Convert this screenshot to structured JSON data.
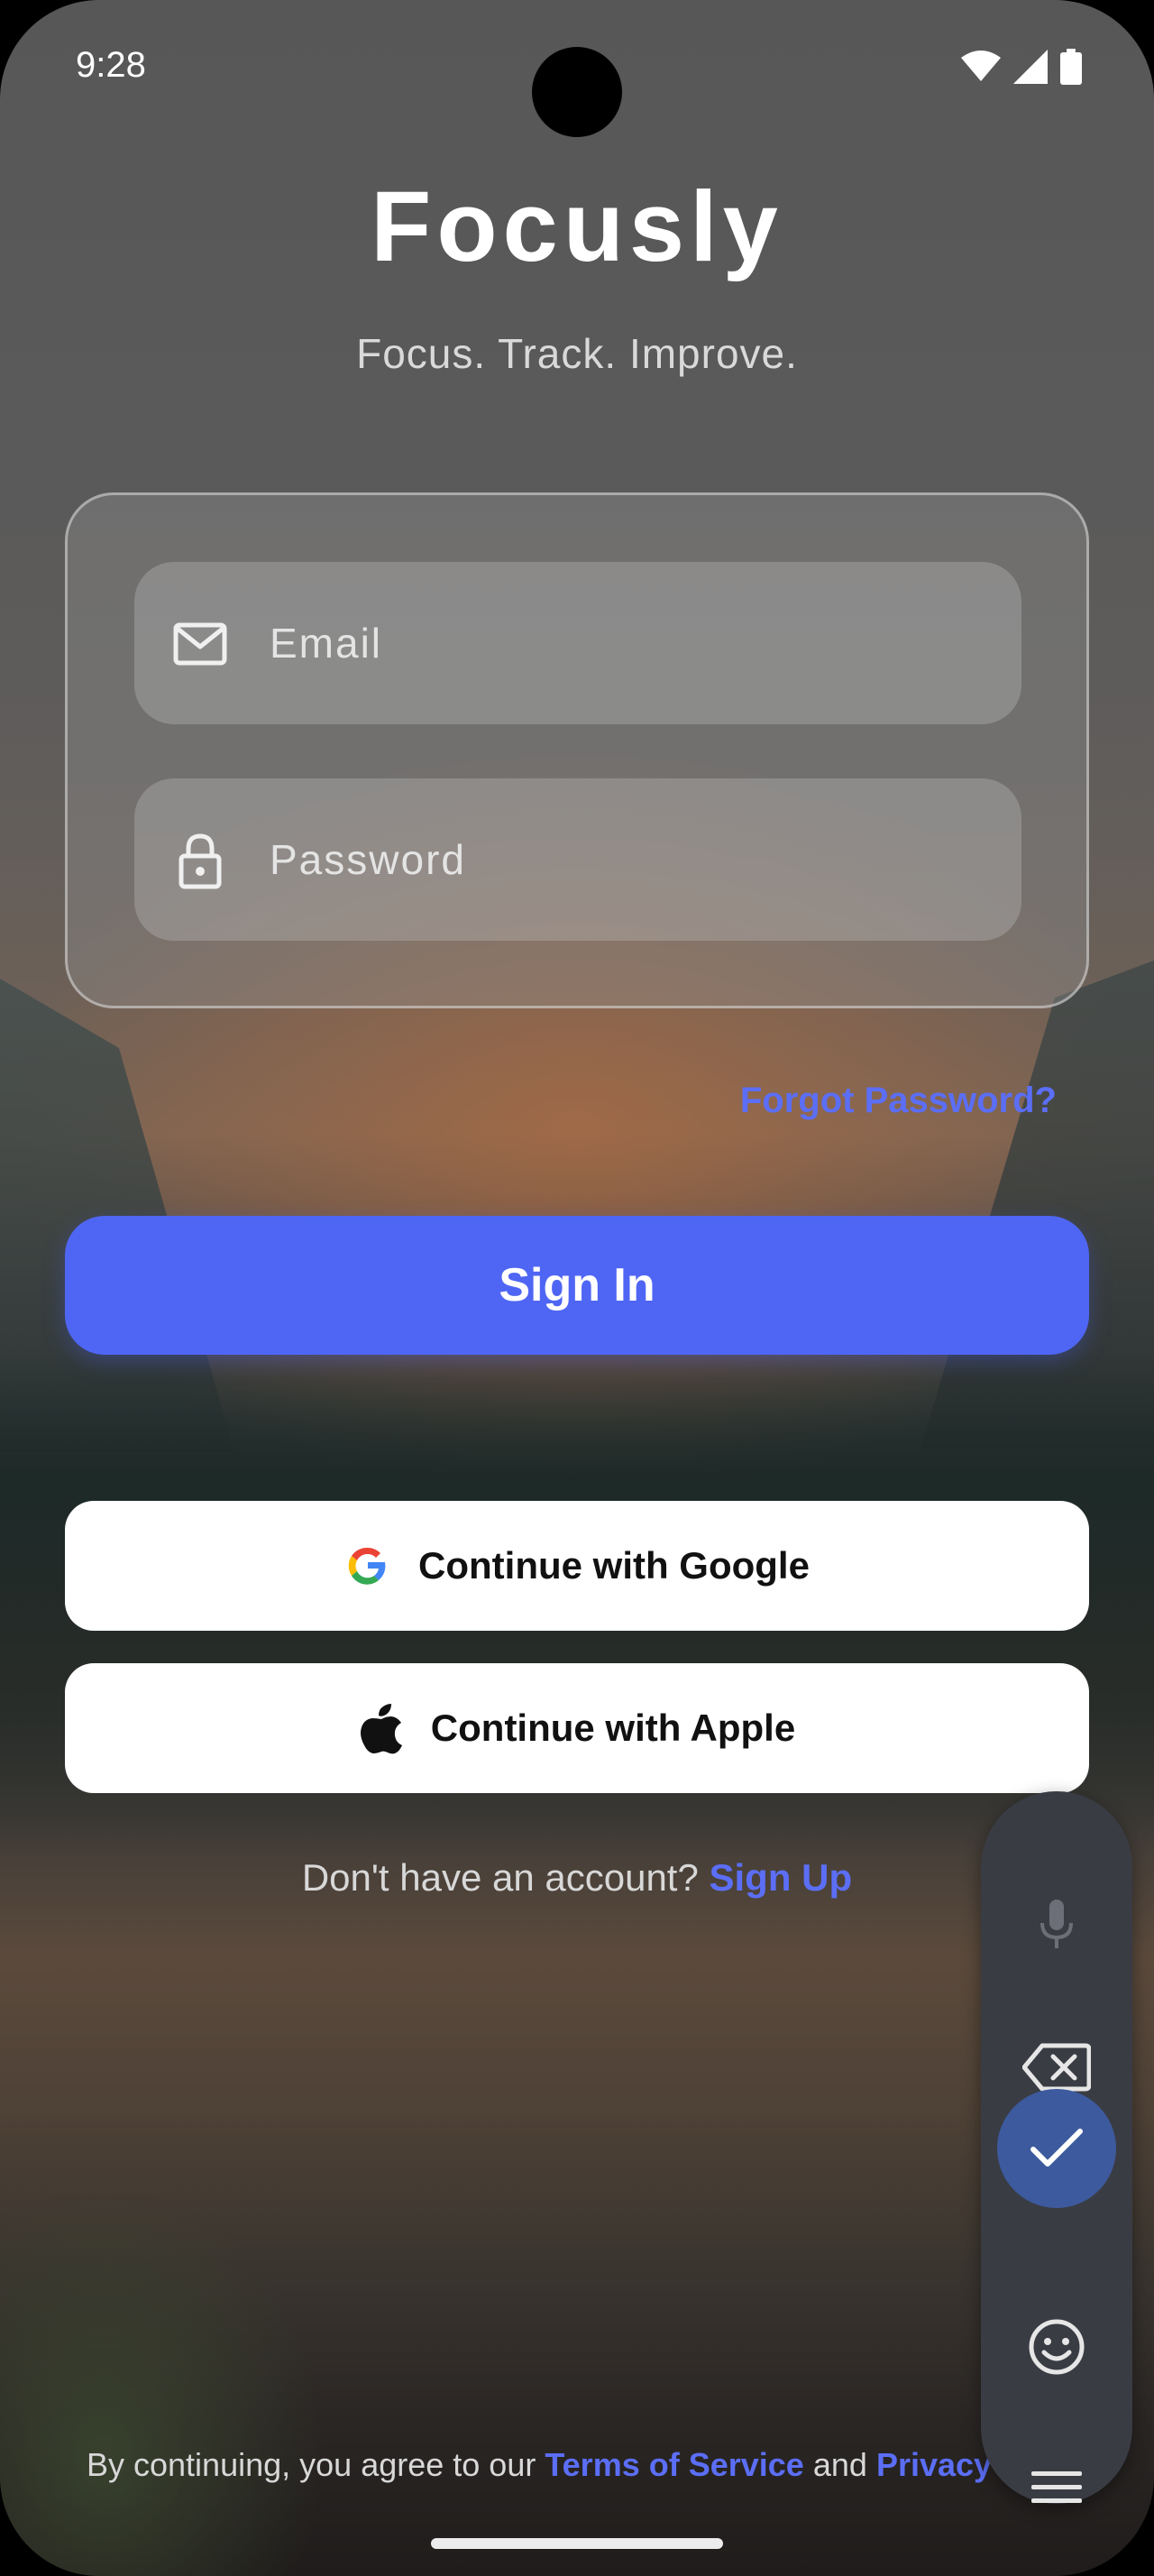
{
  "status_bar": {
    "time": "9:28",
    "icons": [
      "wifi-icon",
      "signal-icon",
      "battery-icon"
    ]
  },
  "header": {
    "title": "Focusly",
    "subtitle": "Focus. Track. Improve."
  },
  "form": {
    "email": {
      "value": "",
      "placeholder": "Email",
      "icon": "mail-icon"
    },
    "password": {
      "value": "",
      "placeholder": "Password",
      "icon": "lock-icon"
    },
    "forgot_label": "Forgot Password?"
  },
  "actions": {
    "signin_label": "Sign In",
    "google_label": "Continue with Google",
    "apple_label": "Continue with Apple"
  },
  "signup": {
    "prompt": "Don't have an account?",
    "link": "Sign Up"
  },
  "terms": {
    "prefix": "By continuing, you agree to our",
    "tos": "Terms of Service",
    "and": "and",
    "privacy": "Privacy Po"
  },
  "keyboard_toolbar": {
    "buttons": [
      "mic-icon",
      "backspace-icon",
      "check-icon",
      "emoji-icon",
      "menu-icon"
    ]
  },
  "colors": {
    "accent": "#4f66f4",
    "link": "#5b6ef5",
    "keyboard_bg": "#3a3c44",
    "keyboard_active": "#3d5a9e"
  }
}
